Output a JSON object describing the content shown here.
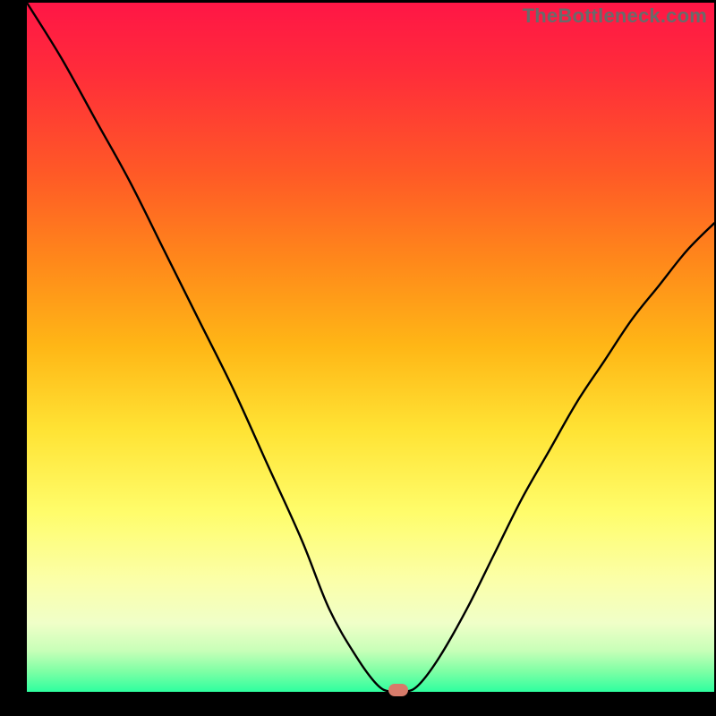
{
  "watermark": "TheBottleneck.com",
  "chart_data": {
    "type": "line",
    "title": "",
    "xlabel": "",
    "ylabel": "",
    "xlim": [
      0,
      100
    ],
    "ylim": [
      0,
      100
    ],
    "background_gradient": {
      "top": "#ff1646",
      "bottom": "#2eff9f",
      "stops": [
        "#ff1646",
        "#ff5a26",
        "#ffb716",
        "#ffe334",
        "#fffd6b",
        "#f0ffc8",
        "#2eff9f"
      ]
    },
    "series": [
      {
        "name": "bottleneck-curve",
        "x": [
          0,
          5,
          10,
          15,
          20,
          25,
          30,
          35,
          40,
          44,
          48,
          51,
          53,
          55,
          57,
          60,
          64,
          68,
          72,
          76,
          80,
          84,
          88,
          92,
          96,
          100
        ],
        "values": [
          100,
          92,
          83,
          74,
          64,
          54,
          44,
          33,
          22,
          12,
          5,
          1,
          0,
          0,
          1,
          5,
          12,
          20,
          28,
          35,
          42,
          48,
          54,
          59,
          64,
          68
        ]
      }
    ],
    "annotations": [
      {
        "name": "marker",
        "x": 54,
        "y": 0,
        "color": "#d77b6a"
      }
    ],
    "grid": false,
    "legend": false
  }
}
